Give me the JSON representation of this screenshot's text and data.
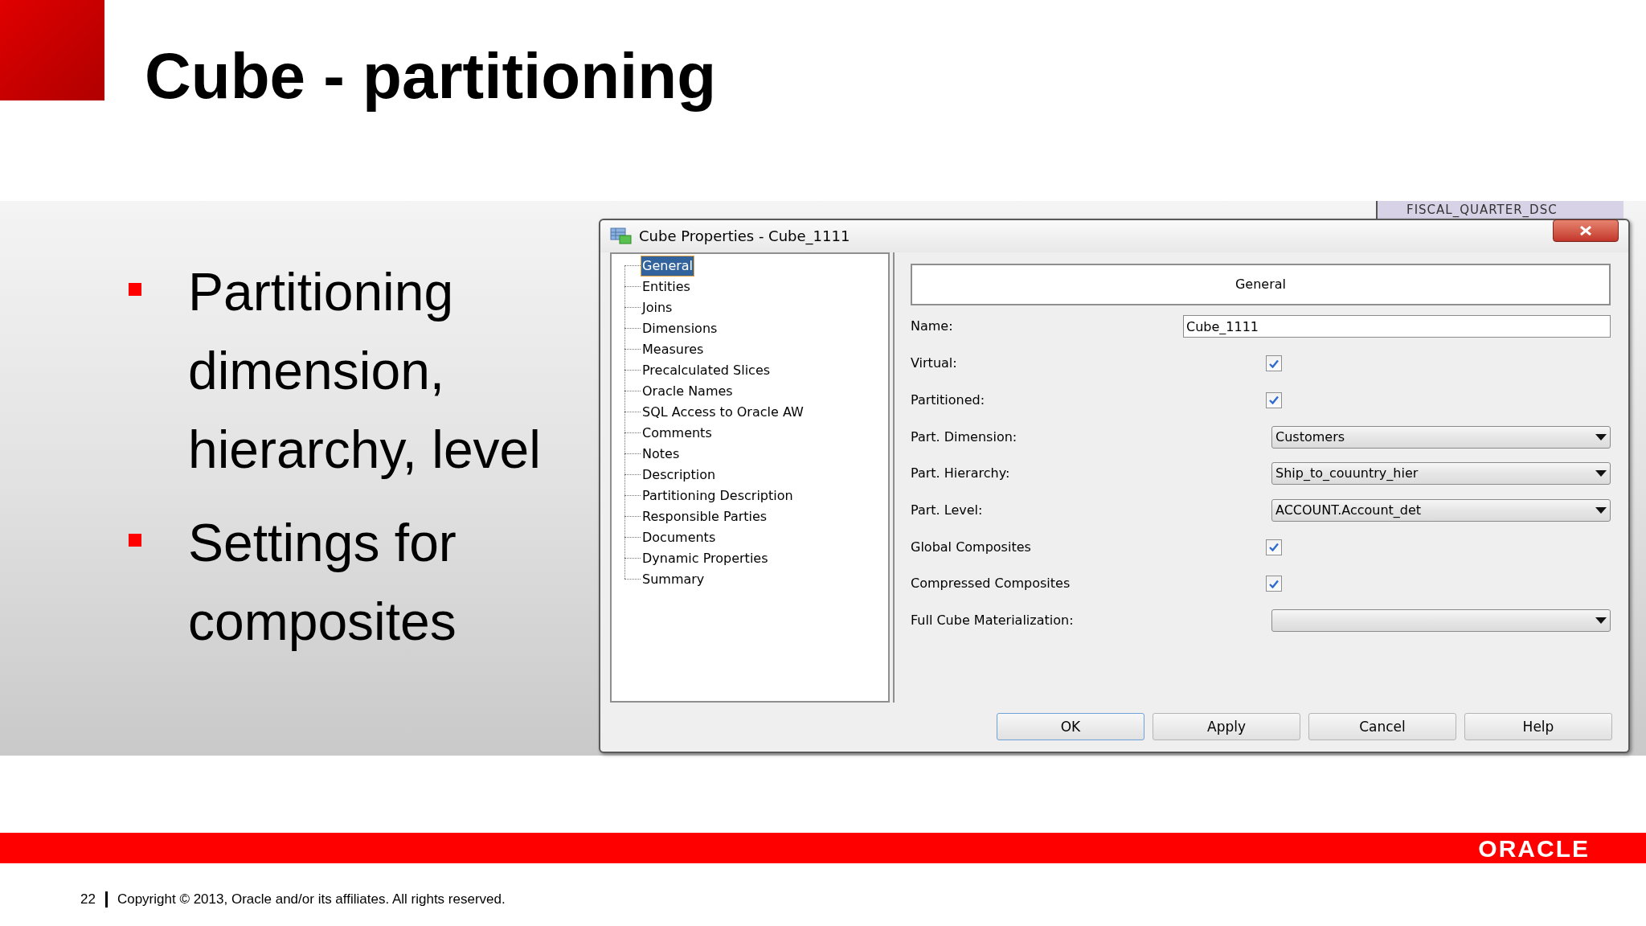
{
  "slide": {
    "title": "Cube - partitioning",
    "bullets": [
      "Partitioning dimension, hierarchy, level",
      "Settings for composites"
    ]
  },
  "background_column": {
    "header": "FISCAL_QUARTER_DSC"
  },
  "dialog": {
    "title": "Cube Properties - Cube_1111",
    "tree": [
      {
        "label": "General",
        "selected": true
      },
      {
        "label": "Entities",
        "selected": false
      },
      {
        "label": "Joins",
        "selected": false
      },
      {
        "label": "Dimensions",
        "selected": false
      },
      {
        "label": "Measures",
        "selected": false
      },
      {
        "label": "Precalculated Slices",
        "selected": false
      },
      {
        "label": "Oracle Names",
        "selected": false
      },
      {
        "label": "SQL Access to Oracle AW",
        "selected": false
      },
      {
        "label": "Comments",
        "selected": false
      },
      {
        "label": "Notes",
        "selected": false
      },
      {
        "label": "Description",
        "selected": false
      },
      {
        "label": "Partitioning Description",
        "selected": false
      },
      {
        "label": "Responsible Parties",
        "selected": false
      },
      {
        "label": "Documents",
        "selected": false
      },
      {
        "label": "Dynamic Properties",
        "selected": false
      },
      {
        "label": "Summary",
        "selected": false
      }
    ],
    "section_header": "General",
    "fields": [
      {
        "kind": "text",
        "label": "Name:",
        "value": "Cube_1111"
      },
      {
        "kind": "checkbox",
        "label": "Virtual:",
        "checked": true
      },
      {
        "kind": "checkbox",
        "label": "Partitioned:",
        "checked": true
      },
      {
        "kind": "dropdown",
        "label": "Part. Dimension:",
        "value": "Customers"
      },
      {
        "kind": "dropdown",
        "label": "Part. Hierarchy:",
        "value": "Ship_to_couuntry_hier"
      },
      {
        "kind": "dropdown",
        "label": "Part. Level:",
        "value": "ACCOUNT.Account_det"
      },
      {
        "kind": "checkbox",
        "label": "Global Composites",
        "checked": true
      },
      {
        "kind": "checkbox",
        "label": "Compressed Composites",
        "checked": true
      },
      {
        "kind": "dropdown",
        "label": "Full Cube Materialization:"
      }
    ],
    "buttons": [
      {
        "label": "OK",
        "default": true
      },
      {
        "label": "Apply",
        "default": false
      },
      {
        "label": "Cancel",
        "default": false
      },
      {
        "label": "Help",
        "default": false
      }
    ]
  },
  "footer": {
    "logo": "ORACLE",
    "page": "22",
    "copyright": "Copyright © 2013, Oracle and/or its affiliates. All rights reserved."
  }
}
